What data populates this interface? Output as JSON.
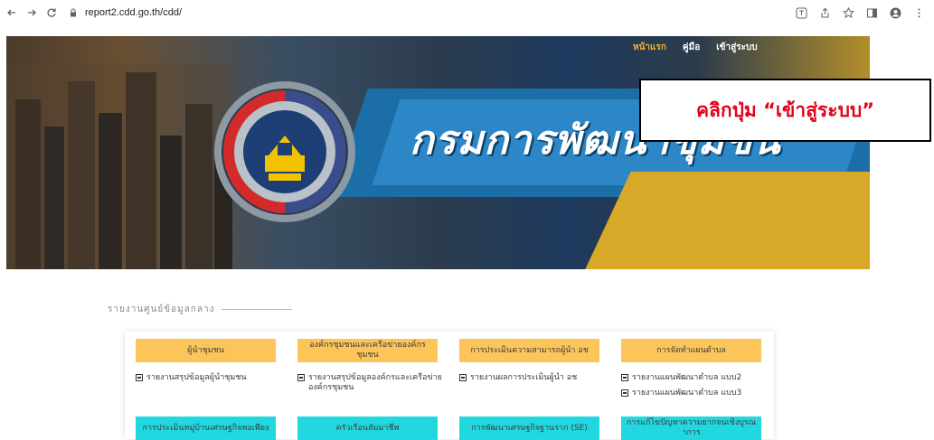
{
  "browser": {
    "url": "report2.cdd.go.th/cdd/"
  },
  "nav": {
    "home": "หน้าแรก",
    "manual": "คู่มือ",
    "login": "เข้าสู่ระบบ"
  },
  "hero": {
    "title": "กรมการพัฒนาชุมชน"
  },
  "callout": {
    "text": "คลิกปุ่ม “เข้าสู่ระบบ”"
  },
  "section": {
    "title": "รายงานศูนย์ข้อมูลกลาง"
  },
  "categories_row1": [
    {
      "label": "ผู้นำชุมชน",
      "links": [
        "รายงานสรุปข้อมูลผู้นำชุมชน"
      ]
    },
    {
      "label": "องค์กรชุมชนและเครือข่ายองค์กรชุมชน",
      "links": [
        "รายงานสรุปข้อมูลองค์กรและเครือข่ายองค์กรชุมชน"
      ]
    },
    {
      "label": "การประเมินความสามารถผู้นำ อช",
      "links": [
        "รายงานผลการประเมินผู้นำ อช"
      ]
    },
    {
      "label": "การจัดทำแผนตำบล",
      "links": [
        "รายงานแผนพัฒนาตำบล แบบ2",
        "รายงานแผนพัฒนาตำบล แบบ3"
      ]
    }
  ],
  "categories_row2": [
    {
      "label": "การประเมินหมู่บ้านเศรษฐกิจพอเพียง"
    },
    {
      "label": "ครัวเรือนสัมมาชีพ"
    },
    {
      "label": "การพัฒนาเศรษฐกิจฐานราก (SE)"
    },
    {
      "label": "การแก้ไขปัญหาความยากจนเชิงบูรณาการ"
    }
  ],
  "colors": {
    "accent_yellow": "#fbc55a",
    "accent_cyan": "#22d8e0",
    "callout_red": "#e2001a",
    "nav_active": "#f5b42a"
  }
}
